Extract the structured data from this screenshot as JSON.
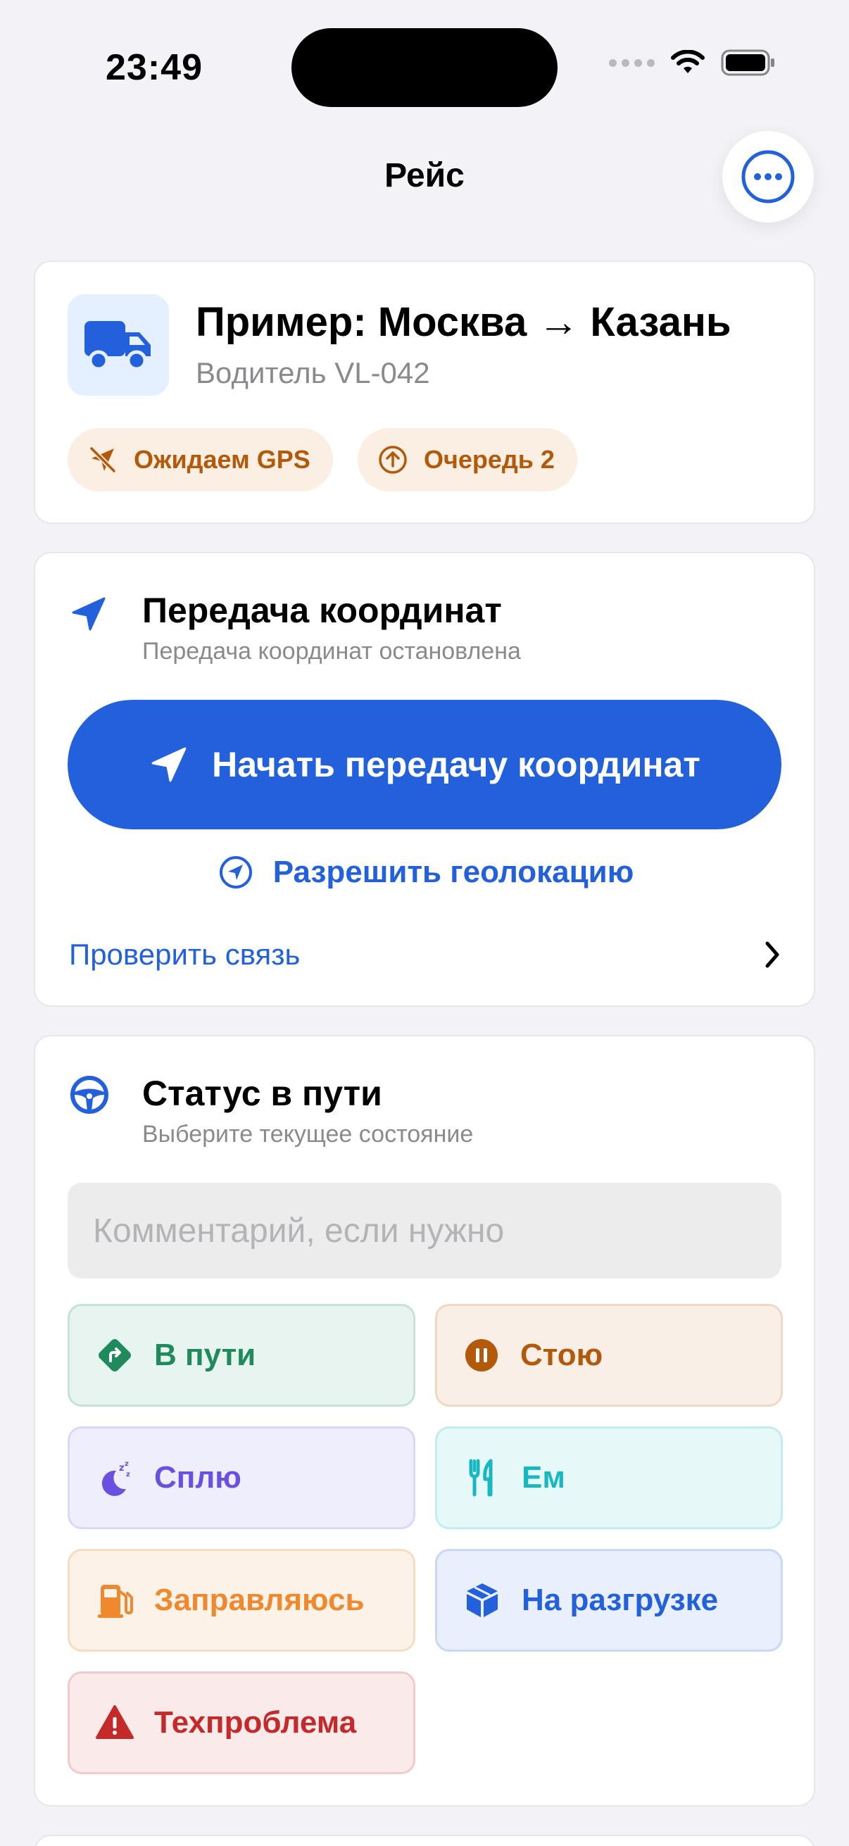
{
  "status_bar": {
    "time": "23:49"
  },
  "header": {
    "title": "Рейс"
  },
  "trip": {
    "title": "Пример: Москва → Казань",
    "driver": "Водитель VL-042",
    "badges": [
      {
        "label": "Ожидаем GPS",
        "icon": "location-off-icon"
      },
      {
        "label": "Очередь 2",
        "icon": "upload-arrow-icon"
      }
    ]
  },
  "coords": {
    "title": "Передача координат",
    "subtitle": "Передача координат остановлена",
    "start_button": "Начать передачу координат",
    "allow_geo": "Разрешить геолокацию",
    "check_link": "Проверить связь"
  },
  "trip_status": {
    "title": "Статус в пути",
    "subtitle": "Выберите текущее состояние",
    "comment_placeholder": "Комментарий, если нужно",
    "comment_value": "",
    "buttons": [
      {
        "label": "В пути",
        "icon": "route-sign-icon",
        "color": "#1f8a5b"
      },
      {
        "label": "Стою",
        "icon": "pause-circle-icon",
        "color": "#b3590a"
      },
      {
        "label": "Сплю",
        "icon": "moon-sleep-icon",
        "color": "#6a4fe0"
      },
      {
        "label": "Ем",
        "icon": "fork-knife-icon",
        "color": "#18b8c2"
      },
      {
        "label": "Заправляюсь",
        "icon": "fuel-pump-icon",
        "color": "#f0882e"
      },
      {
        "label": "На разгрузке",
        "icon": "package-box-icon",
        "color": "#2360dc"
      },
      {
        "label": "Техпроблема",
        "icon": "warning-triangle-icon",
        "color": "#c42a2a"
      }
    ]
  },
  "colors": {
    "accent": "#2360dc",
    "background": "#f2f2f7",
    "badge_bg": "#fbeee2",
    "badge_text": "#b3590a"
  }
}
